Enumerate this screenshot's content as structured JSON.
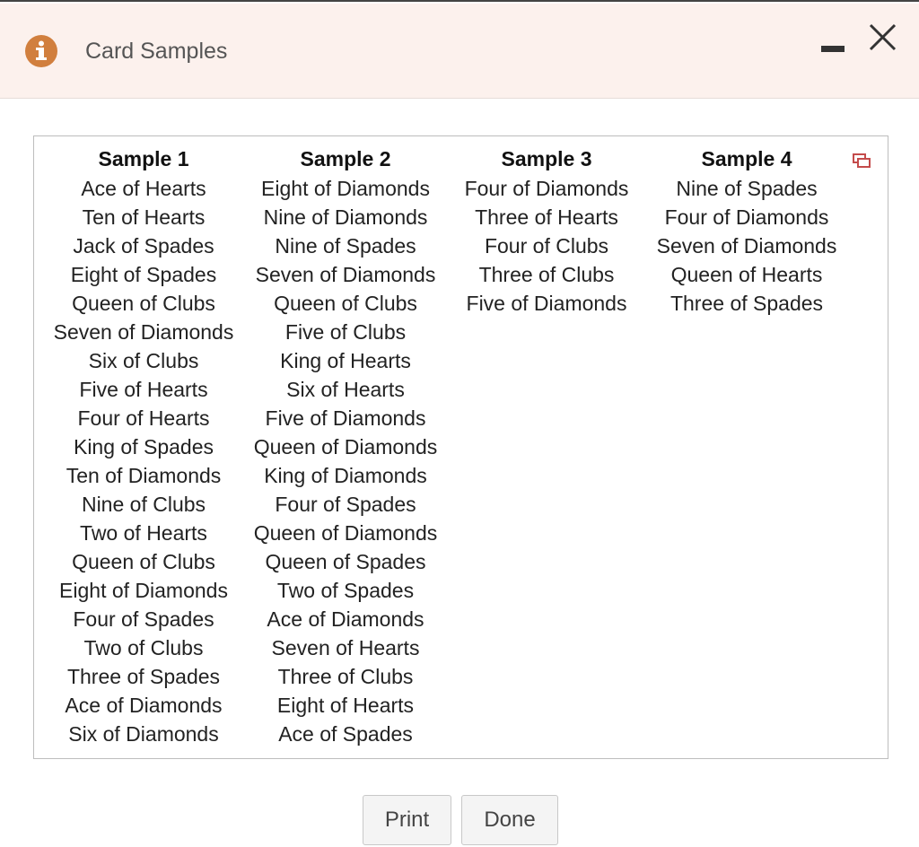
{
  "dialog": {
    "title": "Card Samples",
    "icons": {
      "info": "info-icon",
      "minimize": "minimize-icon",
      "close": "close-icon",
      "popout": "popout-icon"
    },
    "colors": {
      "titlebar_bg": "#fcf1ed",
      "info_icon": "#d17f3e",
      "popout_icon": "#c44b4b"
    }
  },
  "table": {
    "columns": [
      {
        "header": "Sample 1",
        "cells": [
          "Ace of Hearts",
          "Ten of Hearts",
          "Jack of Spades",
          "Eight of Spades",
          "Queen of Clubs",
          "Seven of Diamonds",
          "Six of Clubs",
          "Five of Hearts",
          "Four of Hearts",
          "King of Spades",
          "Ten of Diamonds",
          "Nine of Clubs",
          "Two of Hearts",
          "Queen of Clubs",
          "Eight of Diamonds",
          "Four of Spades",
          "Two of Clubs",
          "Three of Spades",
          "Ace of Diamonds",
          "Six of Diamonds"
        ]
      },
      {
        "header": "Sample 2",
        "cells": [
          "Eight of Diamonds",
          "Nine of Diamonds",
          "Nine of Spades",
          "Seven of Diamonds",
          "Queen of Clubs",
          "Five of Clubs",
          "King of Hearts",
          "Six of Hearts",
          "Five of Diamonds",
          "Queen of Diamonds",
          "King of Diamonds",
          "Four of Spades",
          "Queen of Diamonds",
          "Queen of Spades",
          "Two of Spades",
          "Ace of Diamonds",
          "Seven of Hearts",
          "Three of Clubs",
          "Eight of Hearts",
          "Ace of Spades"
        ]
      },
      {
        "header": "Sample 3",
        "cells": [
          "Four of Diamonds",
          "Three of Hearts",
          "Four of Clubs",
          "Three of Clubs",
          "Five of Diamonds"
        ]
      },
      {
        "header": "Sample 4",
        "cells": [
          "Nine of Spades",
          "Four of Diamonds",
          "Seven of Diamonds",
          "Queen of Hearts",
          "Three of Spades"
        ]
      }
    ]
  },
  "footer": {
    "print_label": "Print",
    "done_label": "Done"
  }
}
